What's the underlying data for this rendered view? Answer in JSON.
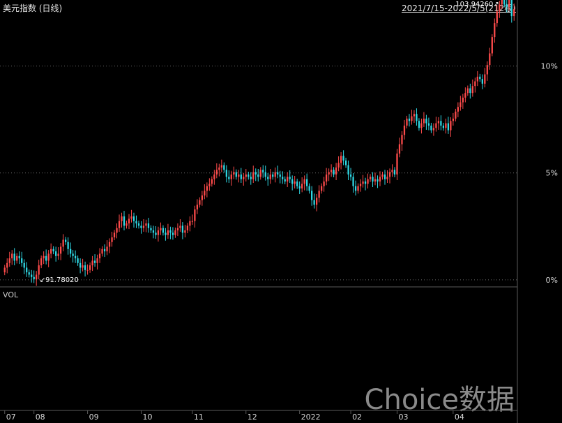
{
  "header": {
    "title": "美元指数 (日线)",
    "range_label": "2021/7/15-2022/5/5(212根)"
  },
  "volume_panel": {
    "label": "VOL"
  },
  "watermark": "Choice数据",
  "colors": {
    "up": "#ff4b4b",
    "down": "#2fd9e6",
    "grid": "#6a6a6a",
    "axis": "#5a5a5a"
  },
  "chart_data": {
    "type": "candlestick",
    "title": "美元指数 (日线)",
    "x_tick_labels": [
      "07",
      "08",
      "09",
      "10",
      "11",
      "12",
      "2022",
      "02",
      "03",
      "04"
    ],
    "y_tick_labels": [
      "0%",
      "5%",
      "10%"
    ],
    "y_ticks_percent": [
      0,
      5,
      10
    ],
    "base_value": 91.7802,
    "ylim_percent": [
      -0.3,
      12.5
    ],
    "annotations": [
      {
        "label": "91.78020",
        "value": 91.7802,
        "type": "low"
      },
      {
        "label": "103.94260",
        "value": 103.9426,
        "type": "high"
      }
    ],
    "series": [
      {
        "month": "07",
        "closes": [
          92.3,
          92.5,
          92.7,
          92.9,
          92.6,
          92.8,
          92.7,
          92.5,
          92.3,
          92.1,
          92.0,
          91.9
        ]
      },
      {
        "month": "08",
        "closes": [
          91.8,
          92.0,
          92.4,
          92.7,
          92.8,
          92.6,
          92.9,
          93.1,
          93.0,
          92.8,
          92.9,
          93.2,
          93.5,
          93.4,
          93.1,
          92.9,
          92.8,
          92.7,
          92.5,
          92.3,
          92.4,
          92.2
        ]
      },
      {
        "month": "09",
        "closes": [
          92.2,
          92.4,
          92.6,
          92.5,
          92.7,
          92.9,
          93.1,
          93.0,
          93.2,
          93.4,
          93.6,
          93.8,
          94.0,
          94.3,
          94.5,
          94.1,
          94.2,
          94.4,
          94.5,
          94.3,
          94.2,
          94.1
        ]
      },
      {
        "month": "10",
        "closes": [
          94.0,
          94.1,
          94.2,
          94.0,
          93.9,
          93.8,
          93.7,
          93.9,
          94.0,
          93.8,
          93.7,
          93.9,
          93.8,
          93.7,
          93.9,
          94.0,
          94.1,
          93.8,
          93.9,
          94.1,
          94.3
        ]
      },
      {
        "month": "11",
        "closes": [
          94.3,
          94.8,
          95.0,
          95.2,
          95.4,
          95.6,
          95.8,
          95.9,
          96.1,
          96.3,
          96.5,
          96.6,
          96.7,
          96.5,
          96.2,
          96.1,
          96.3,
          96.4,
          96.2,
          96.3,
          96.1,
          96.2
        ]
      },
      {
        "month": "12",
        "closes": [
          96.3,
          96.2,
          96.1,
          96.4,
          96.3,
          96.2,
          96.5,
          96.4,
          96.2,
          96.1,
          96.3,
          96.2,
          96.4,
          96.3,
          96.2,
          96.1,
          96.0,
          96.2,
          96.1,
          95.9,
          96.0,
          95.8
        ]
      },
      {
        "month": "2022",
        "closes": [
          95.7,
          95.9,
          96.1,
          95.8,
          95.6,
          95.2,
          95.0,
          95.3,
          95.6,
          95.8,
          96.0,
          96.3,
          96.4,
          96.5,
          96.3,
          96.6,
          96.8,
          97.1,
          96.9,
          96.7,
          96.3
        ]
      },
      {
        "month": "02",
        "closes": [
          96.2,
          95.8,
          95.6,
          95.8,
          95.9,
          96.0,
          95.9,
          96.1,
          96.2,
          96.0,
          96.1,
          96.0,
          96.2,
          96.3,
          96.1,
          96.2,
          96.4,
          96.5,
          96.3
        ]
      },
      {
        "month": "03",
        "closes": [
          97.2,
          97.6,
          98.0,
          98.4,
          98.7,
          98.6,
          98.8,
          98.9,
          98.6,
          98.3,
          98.5,
          98.7,
          98.5,
          98.4,
          98.2,
          98.3,
          98.5,
          98.6,
          98.4,
          98.3,
          98.5,
          98.2,
          98.6
        ]
      },
      {
        "month": "04",
        "closes": [
          98.7,
          99.0,
          99.2,
          99.4,
          99.6,
          99.8,
          100.0,
          99.8,
          100.1,
          100.3,
          100.5,
          100.4,
          100.2,
          100.6,
          101.0,
          101.5,
          102.2,
          102.8,
          103.3,
          103.6,
          103.9,
          103.6
        ]
      },
      {
        "month": "05",
        "closes": [
          103.5,
          103.8,
          103.1,
          103.4
        ]
      }
    ],
    "legend": "none"
  }
}
